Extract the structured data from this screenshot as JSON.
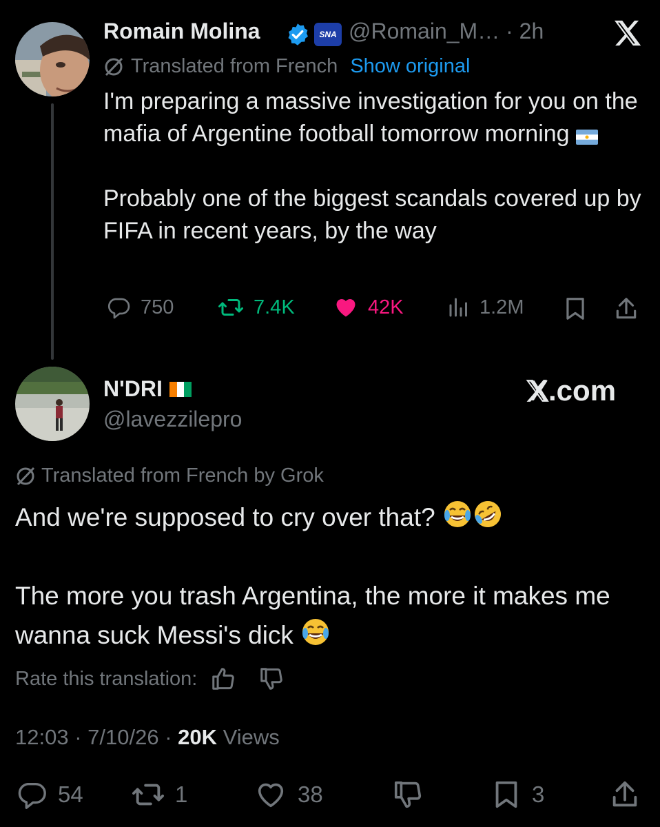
{
  "original_tweet": {
    "author_name": "Romain Molina",
    "handle": "@Romain_M…",
    "separator": "·",
    "time": "2h",
    "translated_label": "Translated from French",
    "show_original": "Show original",
    "text_p1": "I'm preparing a massive investigation for you on the mafia of Argentine football tomorrow morning",
    "text_p2": "Probably one of the biggest scandals covered up by FIFA in recent years, by the way",
    "replies": "750",
    "reposts": "7.4K",
    "likes": "42K",
    "views": "1.2M",
    "badge_text": "SNA",
    "colors": {
      "verified": "#1d9bf0",
      "repost": "#00ba7c",
      "like": "#f91880",
      "link": "#1d9bf0"
    }
  },
  "reply_tweet": {
    "author_name": "N'DRI",
    "handle": "@lavezzilepro",
    "watermark": "X.com",
    "translated_label": "Translated from French by Grok",
    "text_p1": "And we're supposed to cry over that?",
    "text_p2": "The more you trash Argentina, the more it makes me wanna suck Messi's dick",
    "rate_label": "Rate this translation:",
    "time": "12:03",
    "date": "7/10/26",
    "views_count": "20K",
    "views_label": "Views",
    "replies": "54",
    "reposts": "1",
    "likes": "38",
    "bookmarks": "3"
  },
  "icons": [
    "x-logo-icon",
    "verified-badge-icon",
    "org-badge-icon",
    "translate-icon",
    "argentina-flag-icon",
    "ivory-coast-flag-icon",
    "laughing-tears-emoji-icon",
    "rofl-emoji-icon",
    "reply-icon",
    "repost-icon",
    "like-icon",
    "views-icon",
    "bookmark-icon",
    "share-icon",
    "thumbs-up-icon",
    "thumbs-down-icon"
  ]
}
